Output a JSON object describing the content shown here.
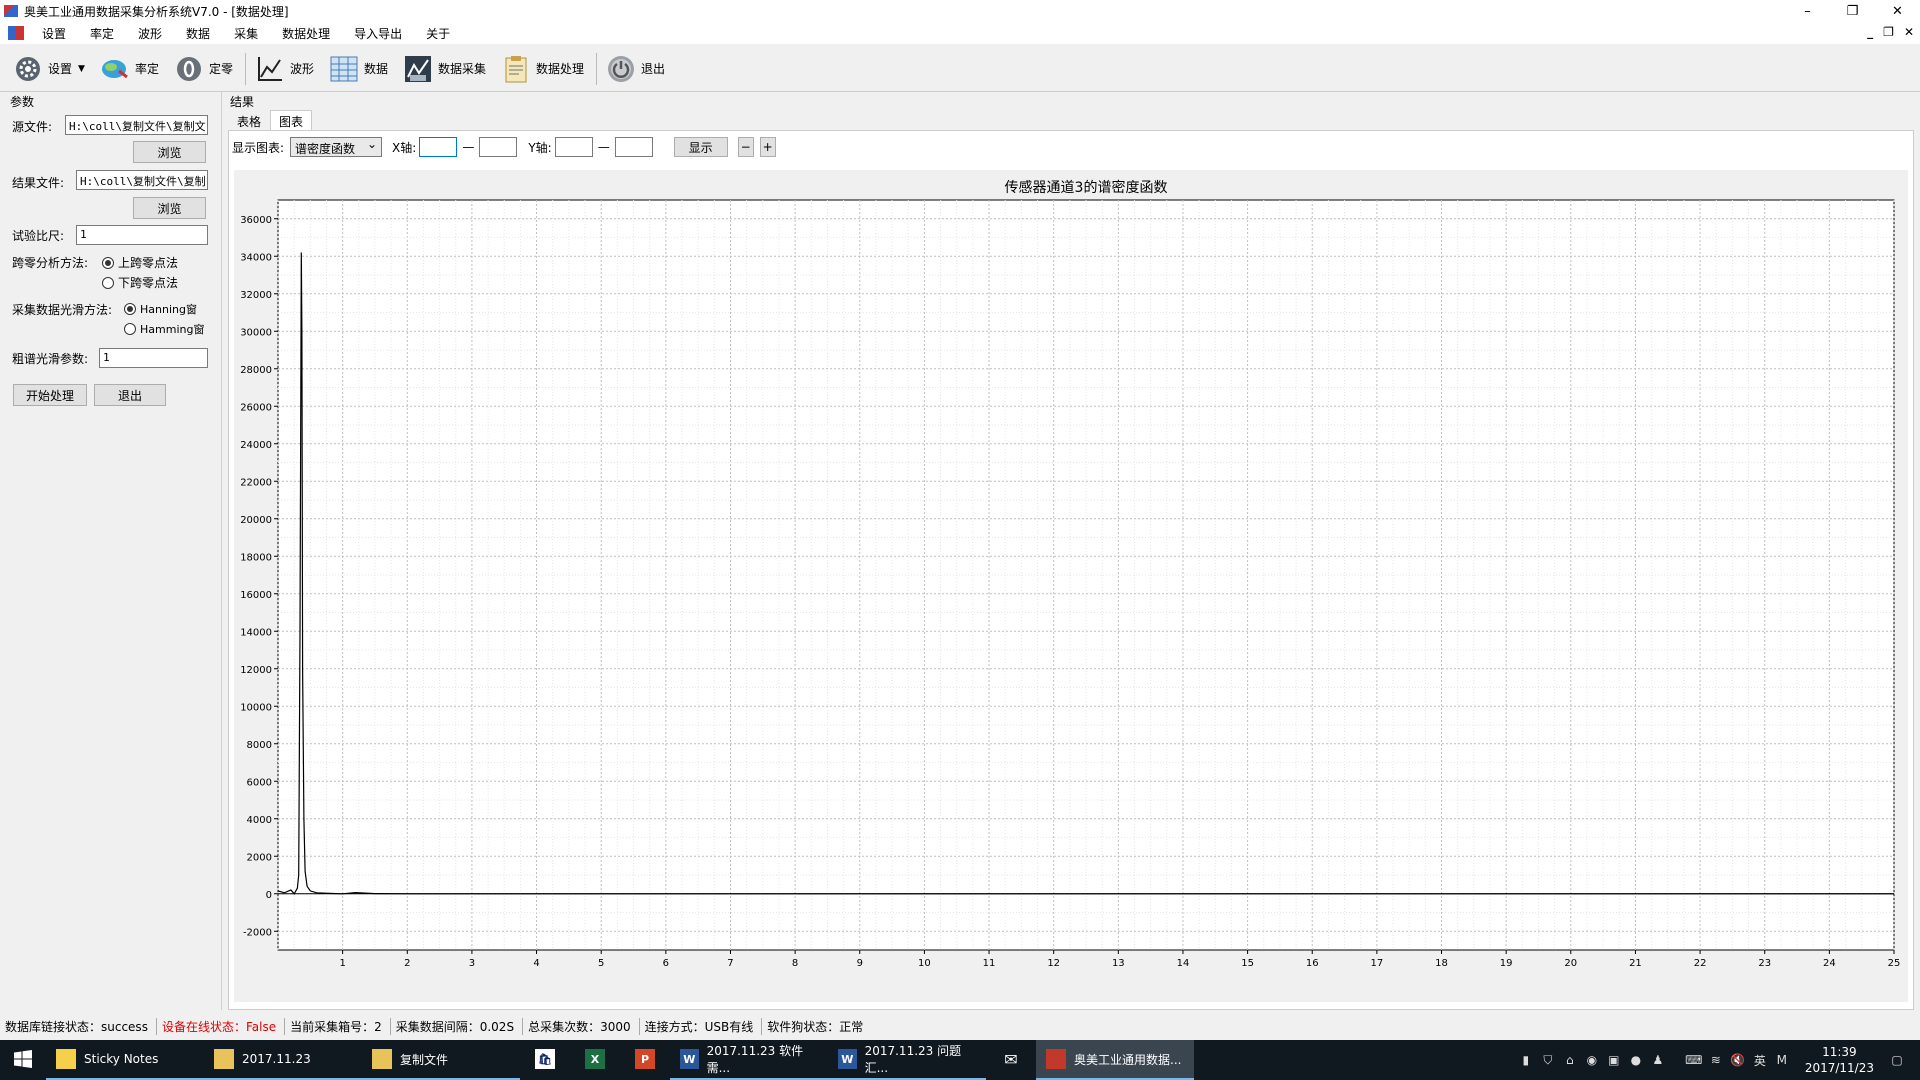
{
  "window": {
    "title": "奥美工业通用数据采集分析系统V7.0 - [数据处理]",
    "controls": [
      "–",
      "❐",
      "✕"
    ]
  },
  "menu": {
    "items": [
      "设置",
      "率定",
      "波形",
      "数据",
      "采集",
      "数据处理",
      "导入导出",
      "关于"
    ],
    "mdi_controls": [
      "_",
      "❐",
      "✕"
    ]
  },
  "toolbar": {
    "settings": "设置",
    "calibrate": "率定",
    "zero": "定零",
    "waveform": "波形",
    "data": "数据",
    "acquire": "数据采集",
    "process": "数据处理",
    "exit": "退出"
  },
  "params": {
    "group_label": "参数",
    "source_label": "源文件:",
    "source_value": "H:\\coll\\复制文件\\复制文",
    "browse1": "浏览",
    "result_label": "结果文件:",
    "result_value": "H:\\coll\\复制文件\\复制",
    "browse2": "浏览",
    "scale_label": "试验比尺:",
    "scale_value": "1",
    "zero_cross_label": "跨零分析方法:",
    "zero_up": "上跨零点法",
    "zero_down": "下跨零点法",
    "smooth_label": "采集数据光滑方法:",
    "smooth_opt1": "Hanning窗",
    "smooth_opt2": "Hamming窗",
    "coarse_label": "粗谱光滑参数:",
    "coarse_value": "1",
    "start": "开始处理",
    "exit": "退出"
  },
  "result": {
    "label": "结果",
    "tabs": [
      "表格",
      "图表"
    ],
    "show_chart_label": "显示图表:",
    "chart_select": "谱密度函数",
    "xaxis_label": "X轴:",
    "yaxis_label": "Y轴:",
    "dash": "—",
    "show_btn": "显示",
    "minus": "−",
    "plus": "+"
  },
  "chart_data": {
    "type": "line",
    "title": "传感器通道3的谱密度函数",
    "xlim": [
      0,
      25
    ],
    "ylim": [
      -3000,
      37000
    ],
    "xticks": [
      1,
      2,
      3,
      4,
      5,
      6,
      7,
      8,
      9,
      10,
      11,
      12,
      13,
      14,
      15,
      16,
      17,
      18,
      19,
      20,
      21,
      22,
      23,
      24,
      25
    ],
    "yticks": [
      -2000,
      0,
      2000,
      4000,
      6000,
      8000,
      10000,
      12000,
      14000,
      16000,
      18000,
      20000,
      22000,
      24000,
      26000,
      28000,
      30000,
      32000,
      34000,
      36000
    ],
    "grid": true,
    "series": [
      {
        "x": [
          0,
          0.1,
          0.2,
          0.25,
          0.3,
          0.32,
          0.34,
          0.36,
          0.37,
          0.38,
          0.4,
          0.42,
          0.45,
          0.5,
          0.6,
          0.8,
          1.0,
          1.2,
          1.5,
          2,
          5,
          10,
          15,
          20,
          25
        ],
        "y": [
          150,
          50,
          200,
          0,
          300,
          1000,
          14000,
          34200,
          30000,
          12000,
          4000,
          1200,
          400,
          150,
          50,
          20,
          0,
          60,
          10,
          0,
          0,
          0,
          0,
          0,
          0
        ]
      }
    ]
  },
  "status": {
    "db": "数据库链接状态：success",
    "device": "设备在线状态：False",
    "box": "当前采集箱号：2",
    "interval": "采集数据间隔：0.02S",
    "count": "总采集次数：3000",
    "conn": "连接方式：USB有线",
    "dongle": "软件狗状态：正常"
  },
  "taskbar": {
    "items": [
      "Sticky Notes",
      "2017.11.23",
      "复制文件",
      "2017.11.23 软件需...",
      "2017.11.23 问题汇...",
      "奥美工业通用数据..."
    ],
    "time": "11:39",
    "date": "2017/11/23",
    "ime": "英"
  }
}
